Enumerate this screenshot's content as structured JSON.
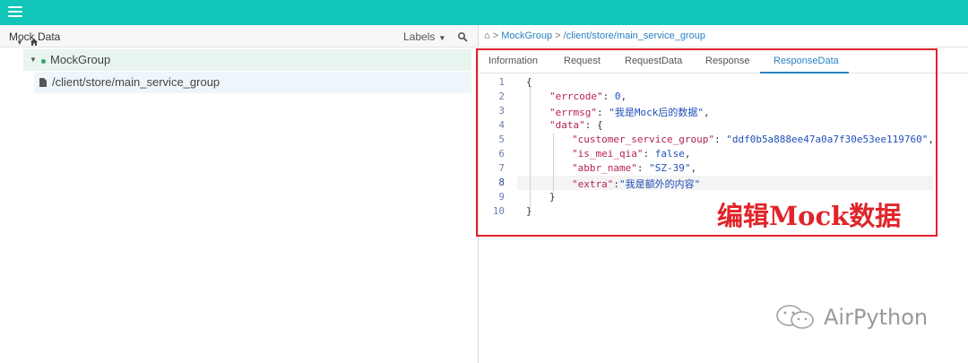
{
  "left_panel": {
    "title": "Mock Data",
    "labels_label": "Labels",
    "tree": {
      "group_label": "MockGroup",
      "file_label": "/client/store/main_service_group"
    }
  },
  "breadcrumb": {
    "sep1": ">",
    "group": "MockGroup",
    "sep2": ">",
    "path": "/client/store/main_service_group"
  },
  "tabs": [
    "Information",
    "Request",
    "RequestData",
    "Response",
    "ResponseData"
  ],
  "active_tab": "ResponseData",
  "editor": {
    "line_numbers": [
      "1",
      "2",
      "3",
      "4",
      "5",
      "6",
      "7",
      "8",
      "9",
      "10"
    ],
    "lines": {
      "l1": "{",
      "l2_key": "\"errcode\"",
      "l2_sep": ": ",
      "l2_val": "0",
      "l2_end": ",",
      "l3_key": "\"errmsg\"",
      "l3_sep": ": ",
      "l3_val": "\"我是Mock后的数据\"",
      "l3_end": ",",
      "l4_key": "\"data\"",
      "l4_sep": ": {",
      "l5_key": "\"customer_service_group\"",
      "l5_sep": ": ",
      "l5_val": "\"ddf0b5a888ee47a0a7f30e53ee119760\"",
      "l5_end": ",",
      "l6_key": "\"is_mei_qia\"",
      "l6_sep": ": ",
      "l6_val": "false",
      "l6_end": ",",
      "l7_key": "\"abbr_name\"",
      "l7_sep": ": ",
      "l7_val": "\"SZ-39\"",
      "l7_end": ",",
      "l8_key": "\"extra\"",
      "l8_sep": ":",
      "l8_val": "\"我是额外的内容\"",
      "l9": "}",
      "l10": "}"
    }
  },
  "annotation_text": "编辑Mock数据",
  "watermark_text": "AirPython",
  "colors": {
    "topbar": "#11c6b9",
    "accent": "#2a82c4",
    "annotation_red": "#e0242b",
    "json_key": "#b5215a",
    "json_value": "#1f4fb6"
  },
  "icons": [
    "menu-icon",
    "search-icon",
    "home-icon",
    "file-icon",
    "wechat-icon"
  ]
}
